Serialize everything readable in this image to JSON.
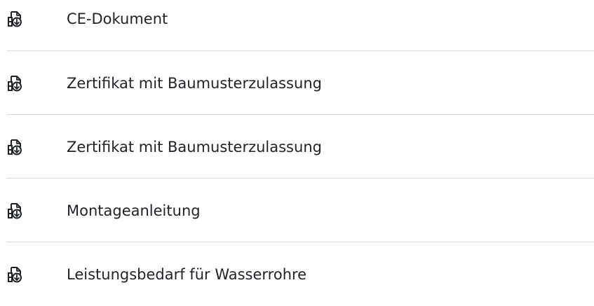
{
  "documents": [
    {
      "label": "CE-Dokument",
      "icon": "file-download-icon"
    },
    {
      "label": "Zertifikat mit Baumusterzulassung",
      "icon": "file-download-icon"
    },
    {
      "label": "Zertifikat mit Baumusterzulassung",
      "icon": "file-download-icon"
    },
    {
      "label": "Montageanleitung",
      "icon": "file-download-icon"
    },
    {
      "label": "Leistungsbedarf für Wasserrohre",
      "icon": "file-download-icon"
    }
  ],
  "colors": {
    "text": "#1f2328",
    "divider": "#d9d9d9",
    "background": "#ffffff"
  }
}
